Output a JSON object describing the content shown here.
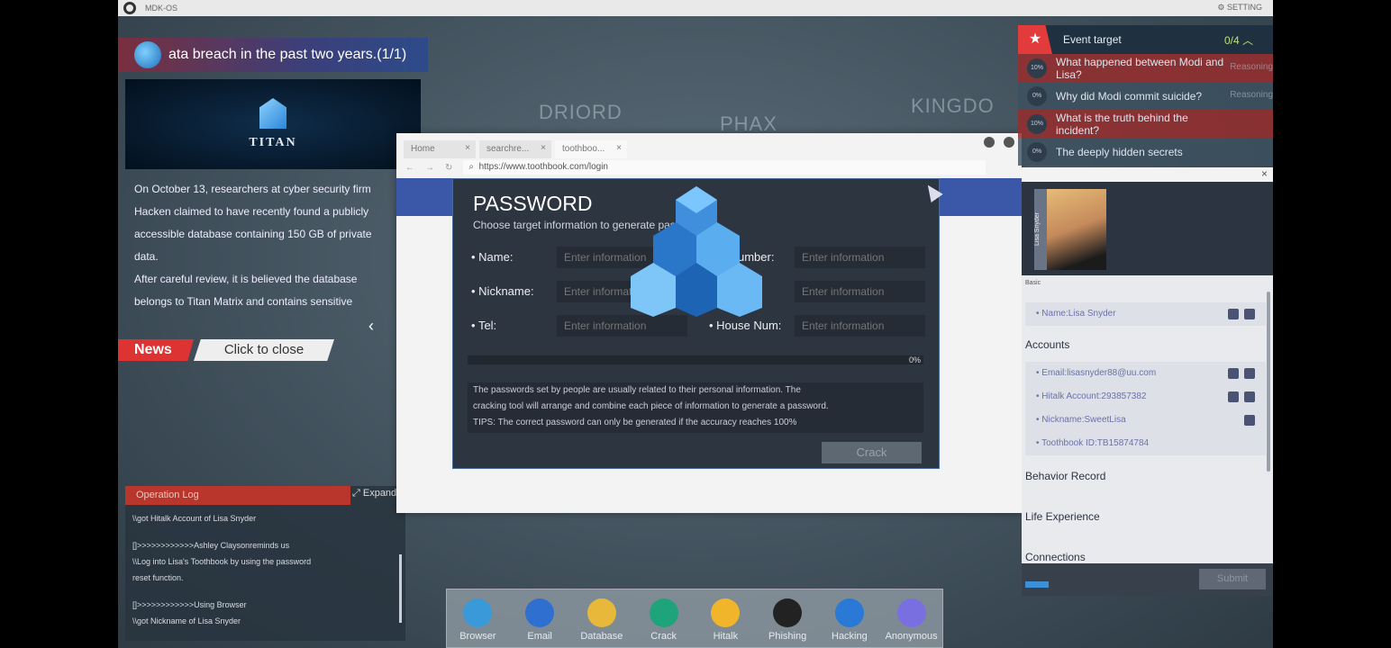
{
  "os": {
    "title": "MDK-OS",
    "setting": "SETTING"
  },
  "map": {
    "labels": [
      "DRIORD",
      "PHAX",
      "KINGDO"
    ]
  },
  "news": {
    "banner": "ata breach in the past two years.(1/1)",
    "image_caption": "TITAN",
    "article": [
      "On October 13, researchers at cyber security firm",
      "Hacken claimed to have recently found a publicly",
      "accessible database containing 150 GB of private",
      "data.",
      "After careful review, it is believed the database",
      "belongs to Titan Matrix and contains sensitive"
    ],
    "tab": "News",
    "close": "Click to close"
  },
  "oplog": {
    "title": "Operation Log",
    "expand": "Expand",
    "lines": [
      "\\\\got Hitalk Account of Lisa Snyder",
      "",
      "[]>>>>>>>>>>>>Ashley Claysonreminds us",
      "\\\\Log into Lisa's Toothbook by using the password",
      "reset function.",
      "",
      "[]>>>>>>>>>>>>Using Browser",
      "\\\\got Nickname of Lisa Snyder"
    ]
  },
  "browser": {
    "tabs": [
      "Home",
      "searchre...",
      "toothboo..."
    ],
    "url": "https://www.toothbook.com/login"
  },
  "password": {
    "title": "PASSWORD",
    "subtitle": "Choose target information to generate password:",
    "fields": [
      {
        "label": "Name:",
        "placeholder": "Enter information"
      },
      {
        "label": "Nickname:",
        "placeholder": "Enter information"
      },
      {
        "label": "Tel:",
        "placeholder": "Enter information"
      },
      {
        "label": "umber:",
        "placeholder": "Enter information"
      },
      {
        "label": "",
        "placeholder": "Enter information"
      },
      {
        "label": "House Num:",
        "placeholder": "Enter information"
      }
    ],
    "progress_percent": 0,
    "progress_label": "0%",
    "tips": [
      "The passwords set by people are usually related to their personal information. The",
      "cracking tool will arrange and combine each piece of information to generate a password.",
      "TIPS: The correct password can only be generated if the accuracy reaches 100%"
    ],
    "crack": "Crack"
  },
  "event": {
    "title": "Event target",
    "count": "0/4",
    "items": [
      {
        "pct": "10%",
        "text": "What happened between Modi and Lisa?",
        "status": "Reasoning",
        "highlight": true
      },
      {
        "pct": "0%",
        "text": "Why did Modi commit suicide?",
        "status": "Reasoning",
        "highlight": false
      },
      {
        "pct": "10%",
        "text": "What is the truth behind the incident?",
        "status": "",
        "highlight": true
      },
      {
        "pct": "0%",
        "text": "The deeply hidden secrets",
        "status": "",
        "highlight": false
      }
    ]
  },
  "profile": {
    "name_tag": "Lisa Snyder",
    "basic": "Basic",
    "name": "• Name:Lisa Snyder",
    "accounts_title": "Accounts",
    "accounts": [
      "• Email:lisasnyder88@uu.com",
      "• Hitalk Account:293857382",
      "• Nickname:SweetLisa",
      "• Toothbook ID:TB15874784"
    ],
    "sections": [
      "Behavior Record",
      "Life Experience",
      "Connections"
    ],
    "submit": "Submit"
  },
  "dock": [
    {
      "label": "Browser",
      "color": "#3a9ad9"
    },
    {
      "label": "Email",
      "color": "#2f6fd0"
    },
    {
      "label": "Database",
      "color": "#e8b83a"
    },
    {
      "label": "Crack",
      "color": "#1fa37a"
    },
    {
      "label": "Hitalk",
      "color": "#f0b52a"
    },
    {
      "label": "Phishing",
      "color": "#222222"
    },
    {
      "label": "Hacking",
      "color": "#2a79d6"
    },
    {
      "label": "Anonymous",
      "color": "#7a6fe0"
    }
  ]
}
